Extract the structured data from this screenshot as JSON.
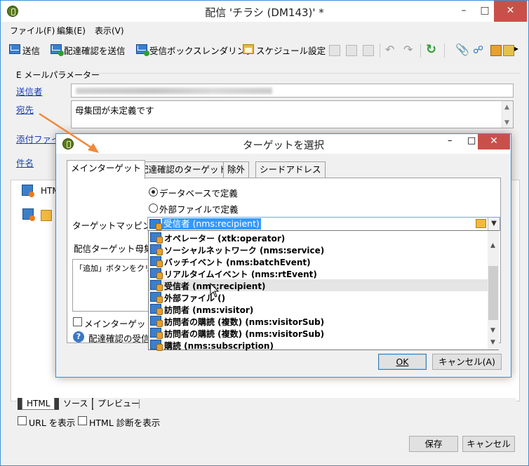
{
  "window": {
    "title": "配信 'チラシ (DM143)' *"
  },
  "menu": [
    "ファイル(F)",
    "編集(E)",
    "表示(V)"
  ],
  "toolbar": {
    "send": "送信",
    "send_proof": "配達確認を送信",
    "inbox_render": "受信ボックスレンダリング",
    "schedule": "スケジュール設定",
    "more": "▸"
  },
  "email_params": {
    "group_label": "E メールパラメーター",
    "sender_label": "送信者",
    "to_label": "宛先",
    "to_value": "母集団が未定義です",
    "attachments_label": "添付ファイル",
    "subject_label": "件名"
  },
  "content": {
    "html_tab_partial": "HTM",
    "bottom_tabs": [
      "HTML",
      "ソース",
      "プレビュー"
    ],
    "show_url": "URL を表示",
    "show_html_diag": "HTML 診断を表示",
    "save": "保存",
    "cancel": "キャンセル"
  },
  "dialog": {
    "title": "ターゲットを選択",
    "tabs": [
      "メインターゲット",
      "配達確認のターゲット",
      "除外",
      "シードアドレス"
    ],
    "radio_db": "データベースで定義",
    "radio_file": "外部ファイルで定義",
    "mapping_label": "ターゲットマッピング:",
    "mapping_selected": "受信者 (nms:recipient)",
    "section_header": "配信ターゲット母集団",
    "list_hint": "「追加」ボタンをクリックして",
    "main_target_chk": "メインターゲットに",
    "help_text": "配達確認の受信",
    "ok": "OK",
    "cancel": "キャンセル(A)"
  },
  "dropdown_options": [
    "オペレーター (xtk:operator)",
    "ソーシャルネットワーク (nms:service)",
    "バッチイベント (nms:batchEvent)",
    "リアルタイムイベント (nms:rtEvent)",
    "受信者 (nms:recipient)",
    "外部ファイル ()",
    "訪問者 (nms:visitor)",
    "訪問者の購読 (複数) (nms:visitorSub)",
    "訪問者の購読 (複数) (nms:visitorSub)",
    "購読 (nms:subscription)"
  ],
  "hovered_option": "受信者 (nms:recipient)",
  "colors": {
    "accent": "#3399ff",
    "close": "#c9504a",
    "link": "#1a3fb0",
    "arrow": "#ee8a3c"
  }
}
